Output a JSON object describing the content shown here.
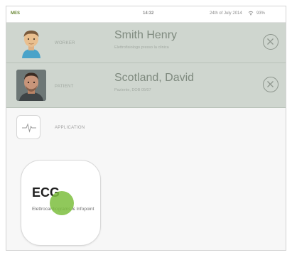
{
  "status_bar": {
    "carrier": "MES",
    "time": "14:32",
    "date": "24th of July 2014",
    "battery": "93%"
  },
  "worker": {
    "role": "WORKER",
    "name": "Smith Henry",
    "subtitle": "Elettrofisiologo presso la clinica"
  },
  "patient": {
    "role": "PATIENT",
    "name": "Scotland, David",
    "subtitle": "Paziente, DOB 05/07"
  },
  "application": {
    "label": "APPLICATION"
  },
  "ecg_tile": {
    "title": "ECG",
    "description": "Elettrocardiograms & Infopoint"
  },
  "colors": {
    "row_background": "#cfd6cf",
    "touch_indicator": "#7dbe3e",
    "carrier_green": "#6d8a3a"
  },
  "icons": {
    "worker_avatar": "worker-avatar-icon",
    "patient_avatar": "patient-photo",
    "close": "close-circle-icon",
    "ecg": "heartbeat-icon",
    "wifi": "wifi-icon"
  }
}
